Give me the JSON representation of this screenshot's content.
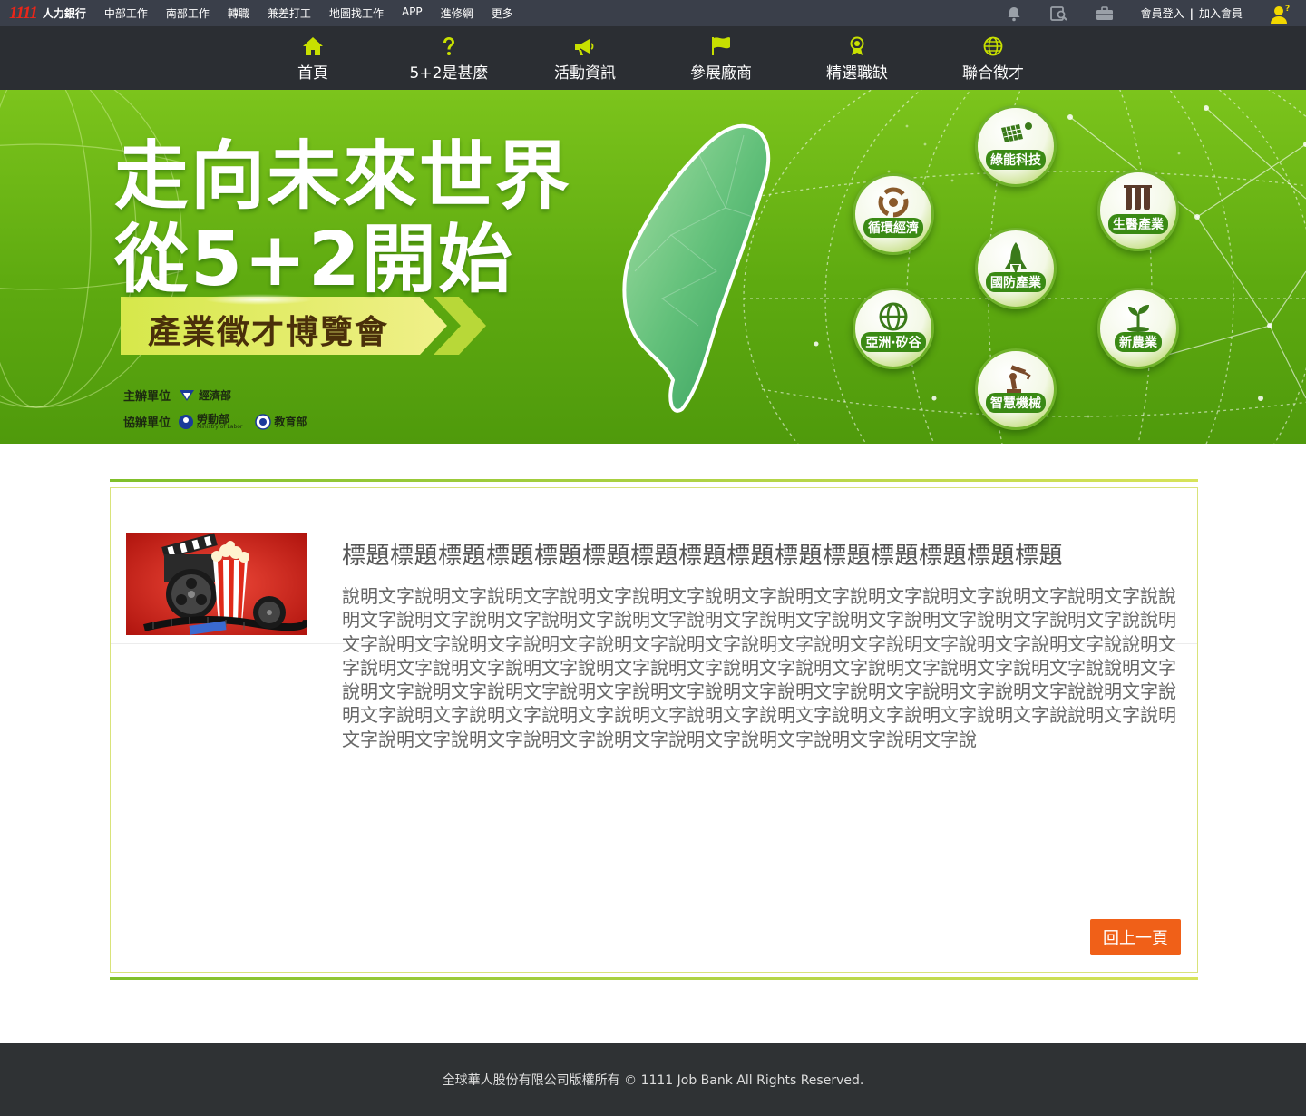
{
  "topbar": {
    "logo_number": "1111",
    "logo_text": "人力銀行",
    "links": [
      "中部工作",
      "南部工作",
      "轉職",
      "兼差打工",
      "地圖找工作",
      "APP",
      "進修網",
      "更多"
    ],
    "member_login": "會員登入",
    "separator": "|",
    "member_join": "加入會員"
  },
  "nav": {
    "items": [
      {
        "label": "首頁",
        "icon": "home-icon"
      },
      {
        "label": "5+2是甚麼",
        "icon": "question-icon"
      },
      {
        "label": "活動資訊",
        "icon": "megaphone-icon"
      },
      {
        "label": "參展廠商",
        "icon": "flag-icon"
      },
      {
        "label": "精選職缺",
        "icon": "medal-icon"
      },
      {
        "label": "聯合徵才",
        "icon": "globe-icon"
      }
    ],
    "icon_color": "#c8e000"
  },
  "banner": {
    "headline_1": "走向未來世界",
    "headline_2": "從5+2開始",
    "expo": "產業徵才博覽會",
    "organizer_label": "主辦單位",
    "organizer": "經濟部",
    "co_organizer_label": "協辦單位",
    "co_organizer_1": "勞動部",
    "co_organizer_1_sub": "Ministry of Labor",
    "co_organizer_2": "教育部",
    "industries": [
      "綠能科技",
      "循環經濟",
      "生醫產業",
      "國防產業",
      "亞洲·矽谷",
      "新農業",
      "智慧機械"
    ]
  },
  "article": {
    "title": "標題標題標題標題標題標題標題標題標題標題標題標題標題標題標題",
    "description": "說明文字說明文字說明文字說明文字說明文字說明文字說明文字說明文字說明文字說明文字說明文字說說明文字說明文字說明文字說明文字說明文字說明文字說明文字說明文字說明文字說明文字說明文字說說明文字說明文字說明文字說明文字說明文字說明文字說明文字說明文字說明文字說明文字說明文字說說明文字說明文字說明文字說明文字說明文字說明文字說明文字說明文字說明文字說明文字說明文字說說明文字說明文字說明文字說明文字說明文字說明文字說明文字說明文字說明文字說明文字說明文字說說明文字說明文字說明文字說明文字說明文字說明文字說明文字說明文字說明文字說明文字說明文字說說明文字說明文字說明文字說明文字說明文字說明文字說明文字說明文字說明文字說明文字說",
    "back_button": "回上一頁"
  },
  "footer": {
    "copyright": "全球華人股份有限公司版權所有 © 1111 Job Bank All Rights Reserved."
  },
  "colors": {
    "accent_green": "#7fbf2a",
    "button_orange": "#f06018",
    "brand_red": "#e8261a"
  }
}
